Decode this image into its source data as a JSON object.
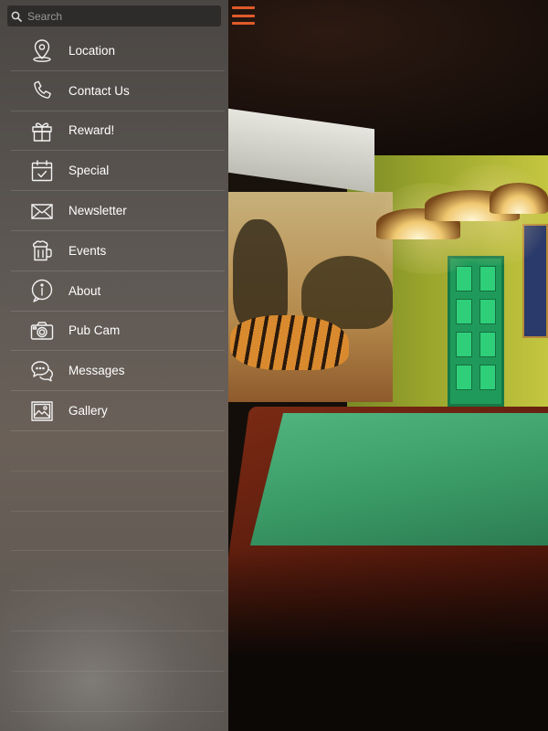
{
  "search": {
    "placeholder": "Search"
  },
  "menu": {
    "items": [
      {
        "label": "Location",
        "icon": "location-pin-icon"
      },
      {
        "label": "Contact Us",
        "icon": "phone-icon"
      },
      {
        "label": "Reward!",
        "icon": "gift-icon"
      },
      {
        "label": "Special",
        "icon": "calendar-check-icon"
      },
      {
        "label": "Newsletter",
        "icon": "envelope-icon"
      },
      {
        "label": "Events",
        "icon": "beer-mug-icon"
      },
      {
        "label": "About",
        "icon": "info-icon"
      },
      {
        "label": "Pub Cam",
        "icon": "camera-icon"
      },
      {
        "label": "Messages",
        "icon": "chat-bubbles-icon"
      },
      {
        "label": "Gallery",
        "icon": "picture-icon"
      }
    ]
  },
  "colors": {
    "accent": "#e05a2a",
    "menu_text": "#ffffff",
    "search_bg": "#2e2c2b"
  }
}
